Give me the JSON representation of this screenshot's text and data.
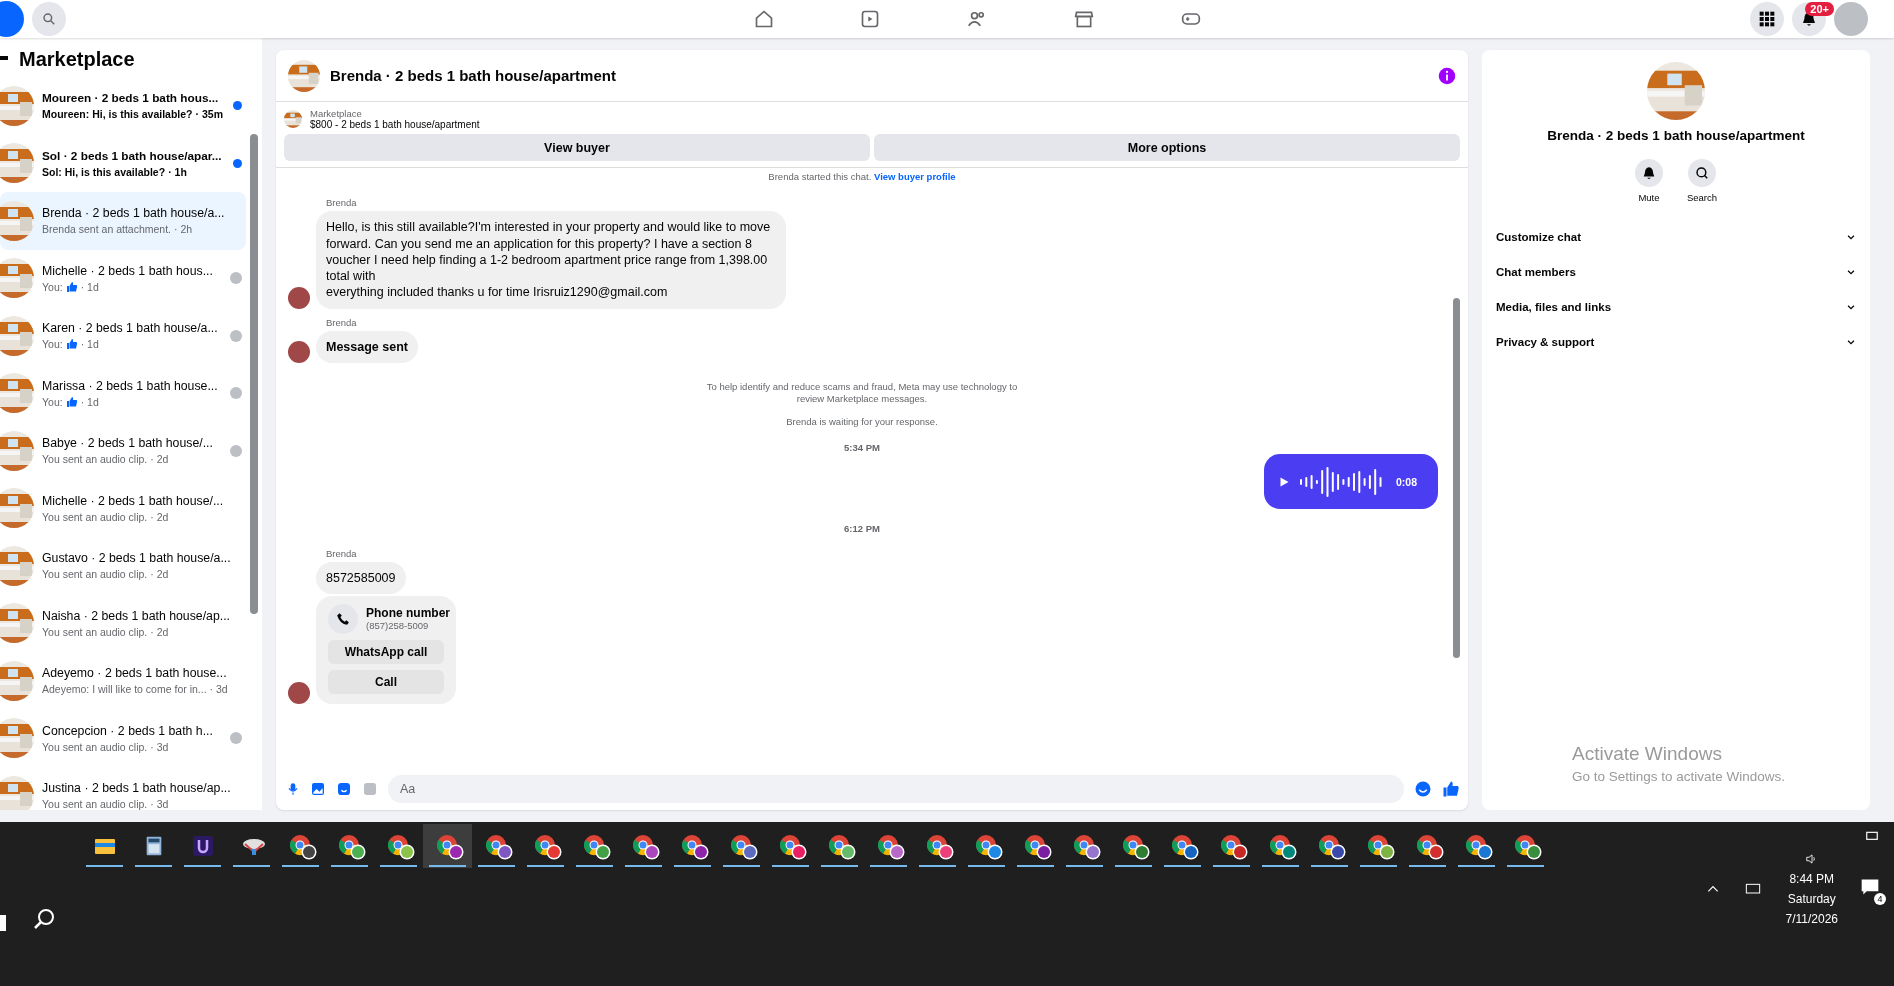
{
  "top_bar": {
    "notification_badge": "20+"
  },
  "sidebar": {
    "title": "Marketplace",
    "items": [
      {
        "title": "Moureen · 2 beds 1 bath hous...",
        "preview": "Moureen: Hi, is this available?",
        "time": "· 35m",
        "unread": true,
        "seen": false,
        "like": false,
        "selected": false
      },
      {
        "title": "Sol · 2 beds 1 bath house/apar...",
        "preview": "Sol: Hi, is this available?",
        "time": "· 1h",
        "unread": true,
        "seen": false,
        "like": false,
        "selected": false
      },
      {
        "title": "Brenda · 2 beds 1 bath house/a...",
        "preview": "Brenda sent an attachment.",
        "time": "· 2h",
        "unread": false,
        "seen": false,
        "like": false,
        "selected": true
      },
      {
        "title": "Michelle · 2 beds 1 bath hous...",
        "preview": "You:",
        "time": "· 1d",
        "unread": false,
        "seen": true,
        "like": true,
        "selected": false
      },
      {
        "title": "Karen · 2 beds 1 bath house/a...",
        "preview": "You:",
        "time": "· 1d",
        "unread": false,
        "seen": true,
        "like": true,
        "selected": false
      },
      {
        "title": "Marissa · 2 beds 1 bath house...",
        "preview": "You:",
        "time": "· 1d",
        "unread": false,
        "seen": true,
        "like": true,
        "selected": false
      },
      {
        "title": "Babye · 2 beds 1 bath house/...",
        "preview": "You sent an audio clip.",
        "time": "· 2d",
        "unread": false,
        "seen": true,
        "like": false,
        "selected": false
      },
      {
        "title": "Michelle · 2 beds 1 bath house/...",
        "preview": "You sent an audio clip.",
        "time": "· 2d",
        "unread": false,
        "seen": false,
        "like": false,
        "selected": false
      },
      {
        "title": "Gustavo · 2 beds 1 bath house/a...",
        "preview": "You sent an audio clip.",
        "time": "· 2d",
        "unread": false,
        "seen": false,
        "like": false,
        "selected": false
      },
      {
        "title": "Naisha · 2 beds 1 bath house/ap...",
        "preview": "You sent an audio clip.",
        "time": "· 2d",
        "unread": false,
        "seen": false,
        "like": false,
        "selected": false
      },
      {
        "title": "Adeyemo · 2 beds 1 bath house...",
        "preview": "Adeyemo: I will like to come for in...",
        "time": "· 3d",
        "unread": false,
        "seen": false,
        "like": false,
        "selected": false
      },
      {
        "title": "Concepcion · 2 beds 1 bath h...",
        "preview": "You sent an audio clip.",
        "time": "· 3d",
        "unread": false,
        "seen": true,
        "like": false,
        "selected": false
      },
      {
        "title": "Justina · 2 beds 1 bath house/ap...",
        "preview": "You sent an audio clip.",
        "time": "· 3d",
        "unread": false,
        "seen": false,
        "like": false,
        "selected": false
      }
    ]
  },
  "chat": {
    "title": "Brenda · 2 beds 1 bath house/apartment",
    "listing": {
      "label": "Marketplace",
      "name": "$800 - 2 beds 1 bath house/apartment"
    },
    "buttons": [
      "View buyer",
      "More options"
    ],
    "started": {
      "text": "Brenda started this chat.",
      "link": "View buyer profile"
    },
    "messages": [
      {
        "kind": "text",
        "sender": "Brenda",
        "lines": [
          "Hello, is this still available?I'm interested in your property and would like to move forward. Can you send me an application for this property?  I have a section 8 voucher I need help finding a 1-2 bedroom apartment price range from 1,398.00 total with",
          "everything included thanks u for time Irisruiz1290@gmail.com"
        ]
      },
      {
        "kind": "bold",
        "sender": "Brenda",
        "text": "Message sent"
      },
      {
        "kind": "notice",
        "lines": [
          "To help identify and reduce scams and fraud, Meta may use technology to review Marketplace messages.",
          "Brenda is waiting for your response."
        ]
      },
      {
        "kind": "time",
        "text": "5:34 PM"
      },
      {
        "kind": "audio",
        "duration": "0:08"
      },
      {
        "kind": "time",
        "text": "6:12 PM"
      },
      {
        "kind": "phone",
        "sender": "Brenda",
        "text": "8572585009",
        "card_title": "Phone number",
        "card_number": "(857)258-5009",
        "actions": [
          "WhatsApp call",
          "Call"
        ]
      }
    ],
    "composer": {
      "placeholder": "Aa"
    }
  },
  "details": {
    "title": "Brenda · 2 beds 1 bath house/apartment",
    "actions": [
      "Mute",
      "Search"
    ],
    "sections": [
      "Customize chat",
      "Chat members",
      "Media, files and links",
      "Privacy & support"
    ]
  },
  "activation": {
    "title": "Activate Windows",
    "text": "Go to Settings to activate Windows."
  },
  "taskbar": {
    "apps": [
      {
        "kind": "folder",
        "selected": false
      },
      {
        "kind": "calculator",
        "selected": false
      },
      {
        "kind": "app",
        "selected": false
      },
      {
        "kind": "network",
        "selected": false
      },
      {
        "kind": "browser",
        "color": "#444444",
        "selected": false
      },
      {
        "kind": "browser",
        "color": "#4caf50",
        "selected": false
      },
      {
        "kind": "browser",
        "color": "#8bc34a",
        "selected": false
      },
      {
        "kind": "browser",
        "color": "#9c27b0",
        "selected": true
      },
      {
        "kind": "browser",
        "color": "#7e57c2",
        "selected": false
      },
      {
        "kind": "browser",
        "color": "#e53935",
        "selected": false
      },
      {
        "kind": "browser",
        "color": "#43a047",
        "selected": false
      },
      {
        "kind": "browser",
        "color": "#ab47bc",
        "selected": false
      },
      {
        "kind": "browser",
        "color": "#8e24aa",
        "selected": false
      },
      {
        "kind": "browser",
        "color": "#5c6bc0",
        "selected": false
      },
      {
        "kind": "browser",
        "color": "#e91e63",
        "selected": false
      },
      {
        "kind": "browser",
        "color": "#66bb6a",
        "selected": false
      },
      {
        "kind": "browser",
        "color": "#ba68c8",
        "selected": false
      },
      {
        "kind": "browser",
        "color": "#ec407a",
        "selected": false
      },
      {
        "kind": "browser",
        "color": "#1e88e5",
        "selected": false
      },
      {
        "kind": "browser",
        "color": "#7b1fa2",
        "selected": false
      },
      {
        "kind": "browser",
        "color": "#9575cd",
        "selected": false
      },
      {
        "kind": "browser",
        "color": "#2e7d32",
        "selected": false
      },
      {
        "kind": "browser",
        "color": "#1565c0",
        "selected": false
      },
      {
        "kind": "browser",
        "color": "#c62828",
        "selected": false
      },
      {
        "kind": "browser",
        "color": "#00897b",
        "selected": false
      },
      {
        "kind": "browser",
        "color": "#3949ab",
        "selected": false
      },
      {
        "kind": "browser",
        "color": "#7cb342",
        "selected": false
      },
      {
        "kind": "browser",
        "color": "#d32f2f",
        "selected": false
      },
      {
        "kind": "browser",
        "color": "#1976d2",
        "selected": false
      },
      {
        "kind": "browser",
        "color": "#388e3c",
        "selected": false
      }
    ],
    "time": "8:44 PM",
    "day": "Saturday",
    "date": "7/11/2026",
    "notification_count": "4"
  }
}
